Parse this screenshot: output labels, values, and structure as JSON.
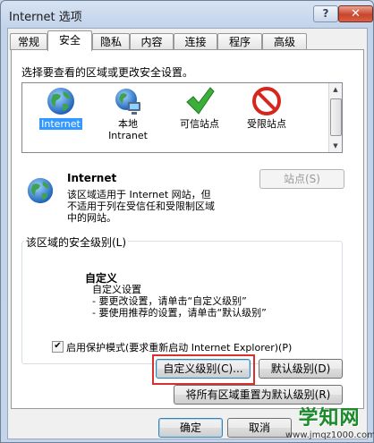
{
  "window": {
    "title": "Internet 选项",
    "help_glyph": "?",
    "close_glyph": "✕"
  },
  "tabs": [
    "常规",
    "安全",
    "隐私",
    "内容",
    "连接",
    "程序",
    "高级"
  ],
  "active_tab": "安全",
  "zones_prompt": "选择要查看的区域或更改安全设置。",
  "zones": [
    {
      "label": "Internet",
      "icon": "globe-icon",
      "selected": true
    },
    {
      "label": "本地\nIntranet",
      "label_line1": "本地",
      "label_line2": "Intranet",
      "icon": "network-globe-icon"
    },
    {
      "label": "可信站点",
      "icon": "green-check-icon"
    },
    {
      "label": "受限站点",
      "icon": "red-no-entry-icon"
    }
  ],
  "zone_info": {
    "name": "Internet",
    "desc_line1": "该区域适用于 Internet 网站，但",
    "desc_line2": "不适用于列在受信任和受限制区域",
    "desc_line3": "中的网站。",
    "sites_button": "站点(S)"
  },
  "security_group": {
    "title": "该区域的安全级别(L)",
    "level_name": "自定义",
    "line1": "自定义设置",
    "line2": "- 要更改设置，请单击“自定义级别”",
    "line3": "- 要使用推荐的设置，请单击“默认级别”"
  },
  "protected_mode": {
    "label": "启用保护模式(要求重新启动 Internet Explorer)(P)",
    "checked": true,
    "check_glyph": "✔"
  },
  "buttons": {
    "custom_level": "自定义级别(C)...",
    "default_level": "默认级别(D)",
    "reset_all": "将所有区域重置为默认级别(R)",
    "ok": "确定",
    "cancel": "取消"
  },
  "watermark": {
    "brand": "学知网",
    "url": "www.jmqz1000.com"
  },
  "colors": {
    "highlight_box": "#d9302f",
    "selection": "#3399ff"
  }
}
